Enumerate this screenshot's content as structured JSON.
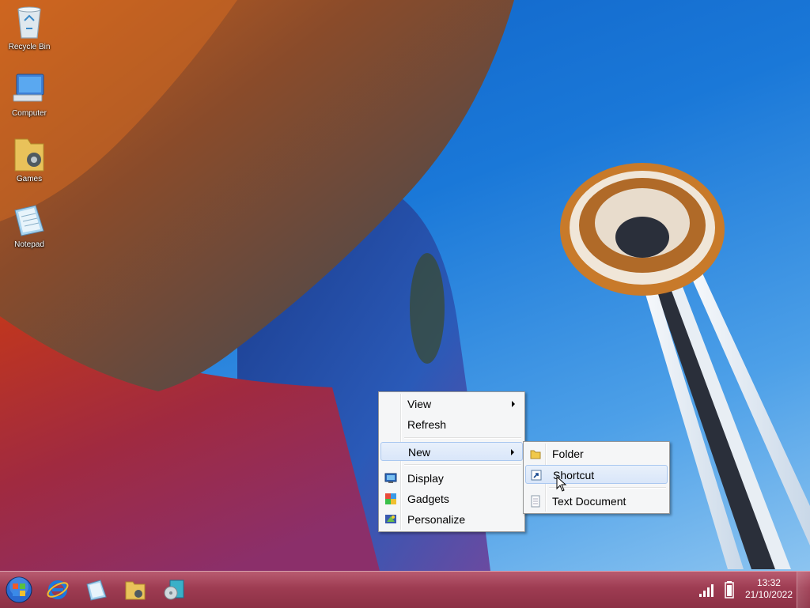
{
  "desktop": {
    "icons": [
      {
        "label": "Recycle Bin",
        "icon": "recycle-bin-icon"
      },
      {
        "label": "Computer",
        "icon": "computer-icon"
      },
      {
        "label": "Games",
        "icon": "games-icon"
      },
      {
        "label": "Notepad",
        "icon": "notepad-icon"
      }
    ]
  },
  "context_menu": {
    "items": [
      {
        "label": "View",
        "has_submenu": true
      },
      {
        "label": "Refresh"
      },
      {
        "label": "New",
        "has_submenu": true,
        "highlighted": true
      },
      {
        "label": "Display",
        "icon": "display-icon"
      },
      {
        "label": "Gadgets",
        "icon": "gadgets-icon"
      },
      {
        "label": "Personalize",
        "icon": "personalize-icon"
      }
    ]
  },
  "submenu_new": {
    "items": [
      {
        "label": "Folder",
        "icon": "folder-icon"
      },
      {
        "label": "Shortcut",
        "icon": "shortcut-icon",
        "highlighted": true
      },
      {
        "label": "Text Document",
        "icon": "text-document-icon"
      }
    ]
  },
  "taskbar": {
    "pinned": [
      "start-orb-icon",
      "internet-explorer-icon",
      "notepad-icon",
      "windows-explorer-icon",
      "media-player-icon"
    ],
    "tray": {
      "time": "13:32",
      "date": "21/10/2022",
      "icons": [
        "signal-icon",
        "battery-icon"
      ]
    }
  },
  "colors": {
    "taskbar": "#9e3c52",
    "menu_bg": "#f5f6f7",
    "menu_highlight": "#d9e6f9",
    "sky": "#1a78d8"
  }
}
